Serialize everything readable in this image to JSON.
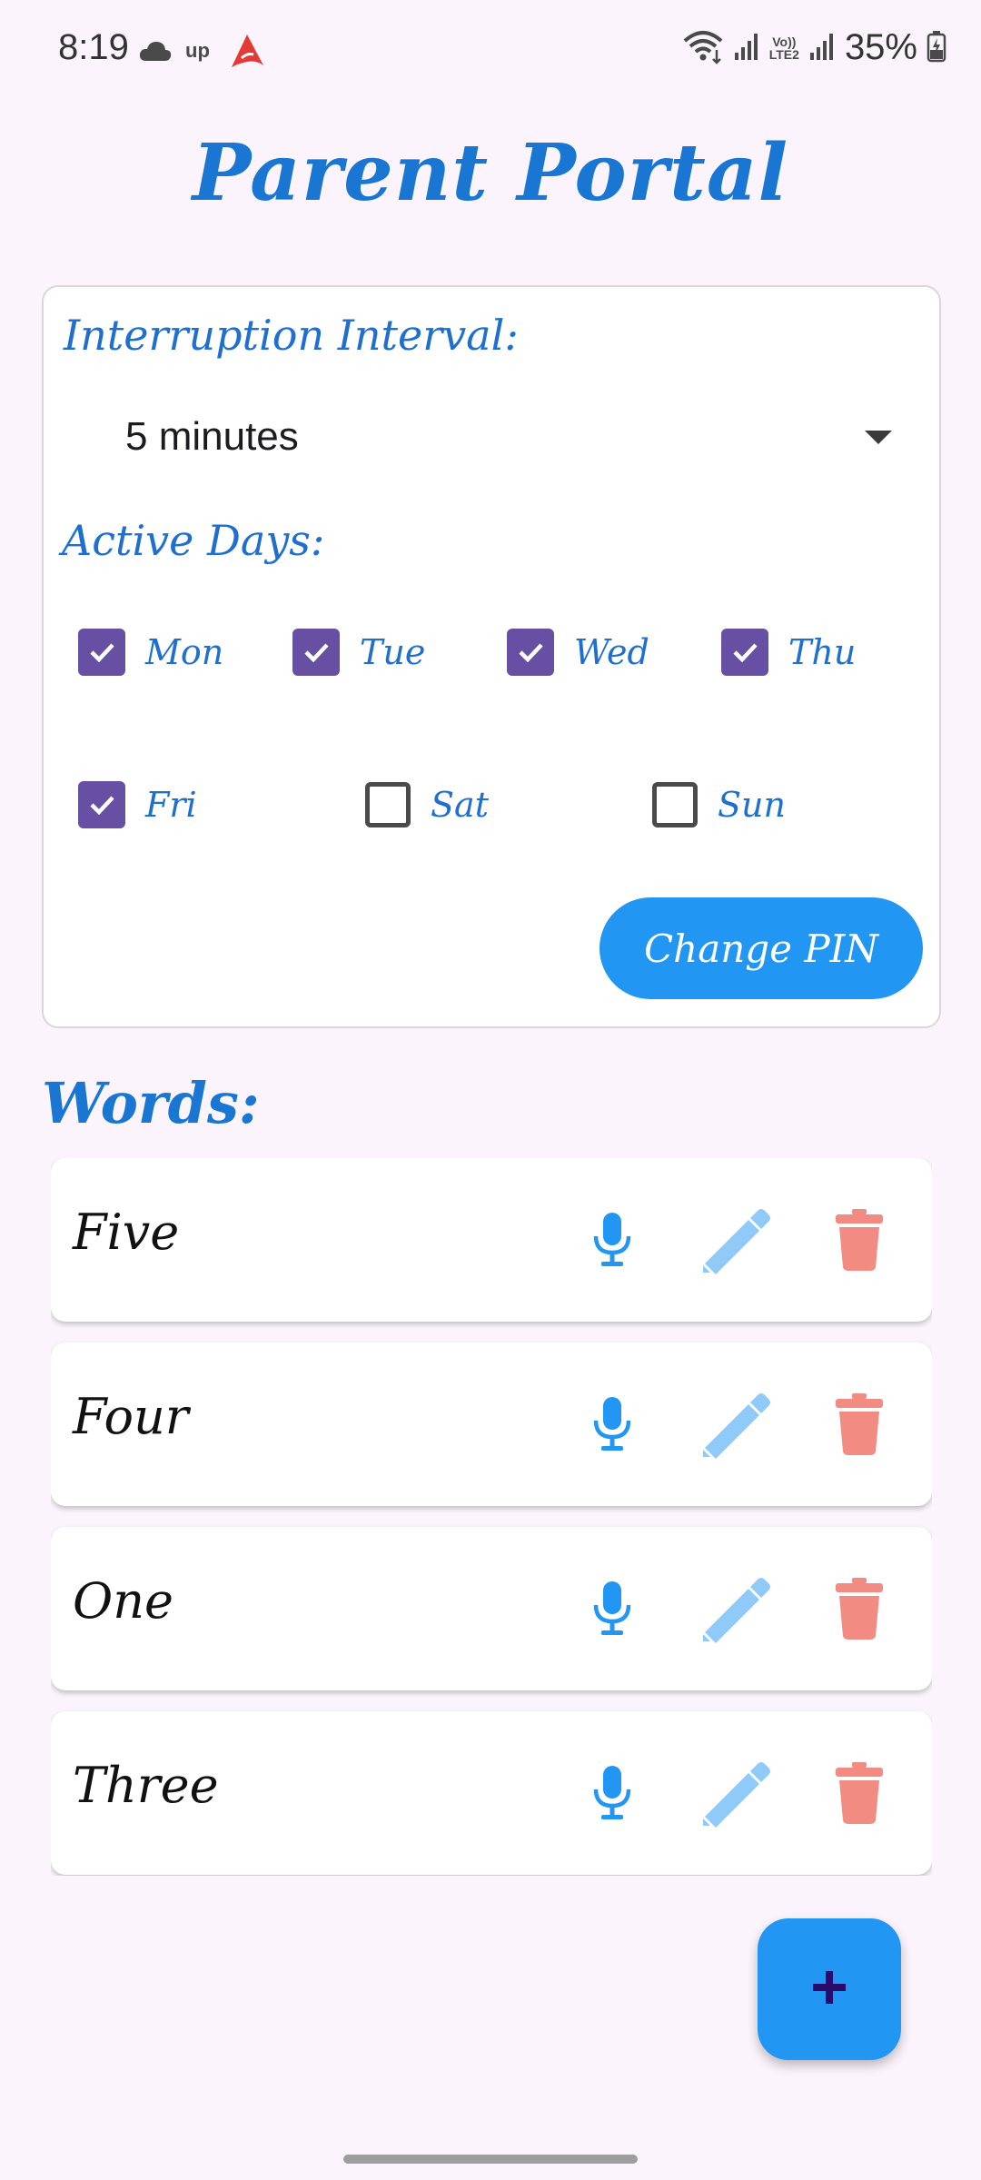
{
  "status_bar": {
    "time": "8:19",
    "battery": "35%",
    "left_icons": [
      "cloud-icon",
      "up-logo-icon",
      "airtel-logo-icon"
    ],
    "right_icons": [
      "wifi-icon",
      "signal-icon",
      "volte-icon",
      "signal-icon",
      "battery-icon"
    ],
    "volte_line1": "Vo))",
    "volte_line2": "LTE2"
  },
  "page": {
    "title": "Parent Portal"
  },
  "settings": {
    "interval_label": "Interruption Interval:",
    "interval_value": "5 minutes",
    "days_label": "Active Days:",
    "days": [
      {
        "label": "Mon",
        "checked": true
      },
      {
        "label": "Tue",
        "checked": true
      },
      {
        "label": "Wed",
        "checked": true
      },
      {
        "label": "Thu",
        "checked": true
      },
      {
        "label": "Fri",
        "checked": true
      },
      {
        "label": "Sat",
        "checked": false
      },
      {
        "label": "Sun",
        "checked": false
      }
    ],
    "change_pin_label": "Change PIN"
  },
  "words": {
    "title": "Words:",
    "items": [
      {
        "word": "Five"
      },
      {
        "word": "Four"
      },
      {
        "word": "One"
      },
      {
        "word": "Three"
      }
    ],
    "action_icons": [
      "microphone-icon",
      "pencil-icon",
      "trash-icon"
    ]
  },
  "fab": {
    "icon": "plus-icon"
  },
  "colors": {
    "background": "#fbf4fc",
    "accent_blue": "#2196f3",
    "title_blue": "#1976d2",
    "checkbox_purple": "#6750a4",
    "delete_red": "#f28b82",
    "edit_light_blue": "#90caf9",
    "fab_plus": "#2a0a6b"
  }
}
